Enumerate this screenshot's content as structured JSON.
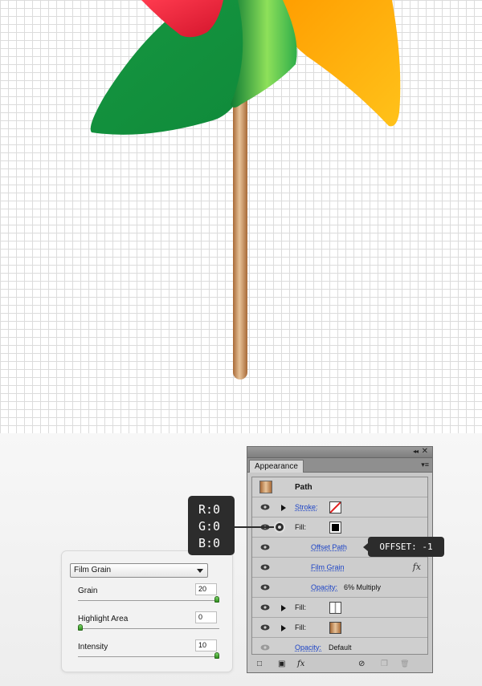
{
  "panel": {
    "tab_label": "Appearance",
    "collapse_glyph": "◂◂",
    "close_glyph": "✕",
    "menu_glyph": "▾≡",
    "object_label": "Path",
    "rows": {
      "stroke_label": "Stroke:",
      "fill1_label": "Fill:",
      "offset_path_label": "Offset Path",
      "film_grain_label": "Film Grain",
      "fx_glyph": "fx",
      "opacity_inner_label": "Opacity:",
      "opacity_inner_value": "6% Multiply",
      "fill2_label": "Fill:",
      "fill3_label": "Fill:",
      "opacity_label": "Opacity:",
      "opacity_value": "Default"
    },
    "footer": {
      "new_stroke_glyph": "□",
      "new_fill_glyph": "▣",
      "fx_glyph": "fx",
      "clear_glyph": "⊘",
      "duplicate_glyph": "❐",
      "delete_glyph": "🗑"
    },
    "colors": {
      "fill1": "#000000",
      "eye_active": "#3a3a3a",
      "eye_inactive": "#9a9a9a"
    }
  },
  "film_grain": {
    "dropdown_value": "Film Grain",
    "grain_label": "Grain",
    "grain_value": "20",
    "grain_level": 1.0,
    "highlight_label": "Highlight Area",
    "highlight_value": "0",
    "highlight_level": 0.0,
    "intensity_label": "Intensity",
    "intensity_value": "10",
    "intensity_level": 1.0
  },
  "callouts": {
    "rgb_r": "R:0",
    "rgb_g": "G:0",
    "rgb_b": "B:0",
    "offset": "OFFSET: -1"
  },
  "artwork_colors": {
    "red": "#e8283c",
    "green": "#1aa548",
    "green_light": "#7ed44f",
    "orange": "#ffa90a",
    "stick": "#c98e58"
  }
}
